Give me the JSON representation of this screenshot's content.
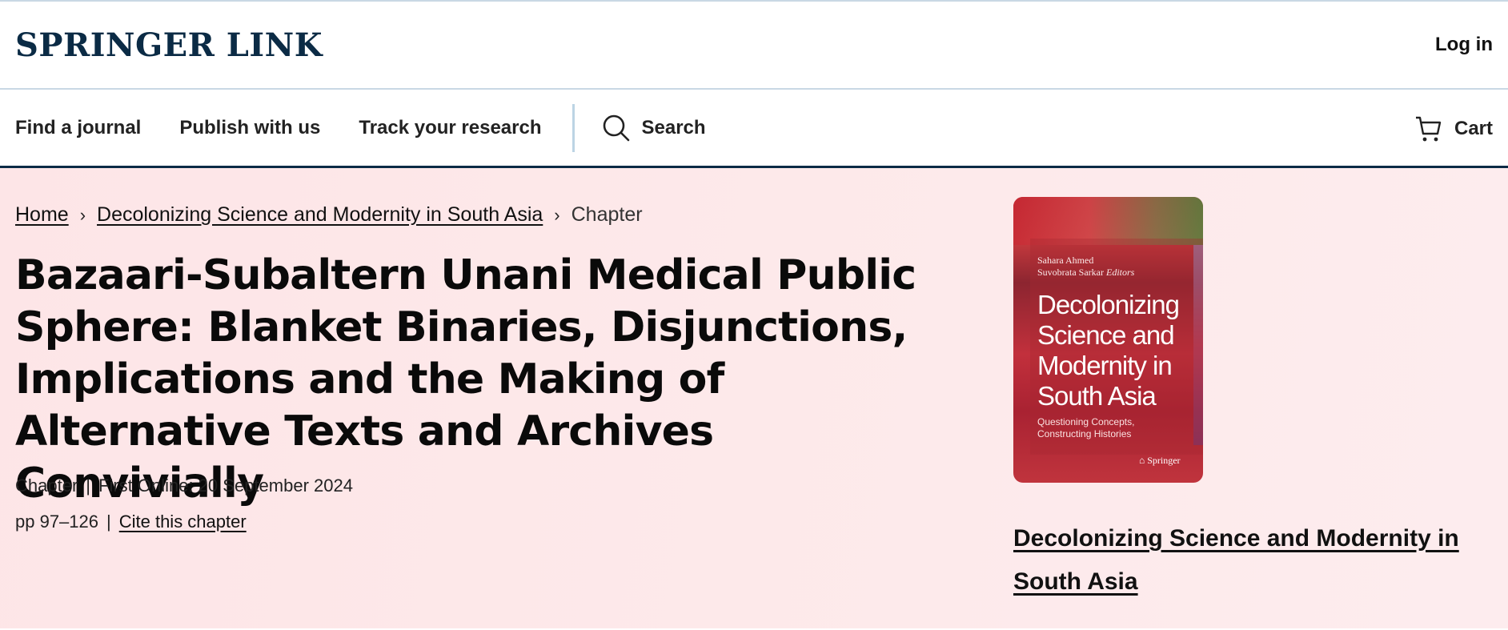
{
  "header": {
    "logo": "SPRINGER LINK",
    "login_label": "Log in"
  },
  "nav": {
    "items": [
      {
        "label": "Find a journal"
      },
      {
        "label": "Publish with us"
      },
      {
        "label": "Track your research"
      }
    ],
    "search_label": "Search",
    "cart_label": "Cart"
  },
  "breadcrumb": {
    "home": "Home",
    "book": "Decolonizing Science and Modernity in South Asia",
    "current": "Chapter"
  },
  "chapter": {
    "title": "Bazaari-Subaltern Unani Medical Public Sphere: Blanket Binaries, Disjunctions, Implications and the Making of Alternative Texts and Archives Convivially",
    "type": "Chapter",
    "first_online": "First Online: 20 September 2024",
    "pages": "pp 97–126",
    "cite_label": "Cite this chapter"
  },
  "book": {
    "cover": {
      "editor1": "Sahara Ahmed",
      "editor2": "Suvobrata Sarkar",
      "editors_tag": "Editors",
      "title": "Decolonizing Science and Modernity in South Asia",
      "subtitle": "Questioning Concepts, Constructing Histories",
      "publisher": "Springer"
    },
    "link_title": "Decolonizing Science and Modernity in South Asia"
  },
  "colors": {
    "brand_navy": "#0b2b45",
    "hero_background": "#fde7e9"
  }
}
